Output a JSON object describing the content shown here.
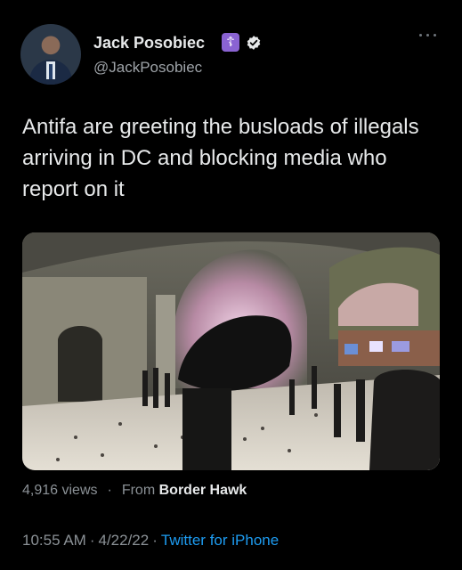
{
  "author": {
    "name": "Jack Posobiec",
    "handle": "@JackPosobiec",
    "badge_icon": "orthodox-cross-icon",
    "verified": true
  },
  "tweet": {
    "text": "Antifa are greeting the busloads of illegals arriving in DC and blocking media who report on it"
  },
  "media": {
    "type": "video-still",
    "description_icon": "video-thumbnail"
  },
  "stats": {
    "views": "4,916 views",
    "separator": "·",
    "from_label": "From",
    "from_source": "Border Hawk"
  },
  "footer": {
    "time": "10:55 AM",
    "date": "4/22/22",
    "client": "Twitter for iPhone",
    "separator": "·"
  },
  "colors": {
    "background": "#000000",
    "text": "#e7e9ea",
    "secondary": "#8b9196",
    "link": "#1d9bf0",
    "badge": "#8a63d2"
  }
}
